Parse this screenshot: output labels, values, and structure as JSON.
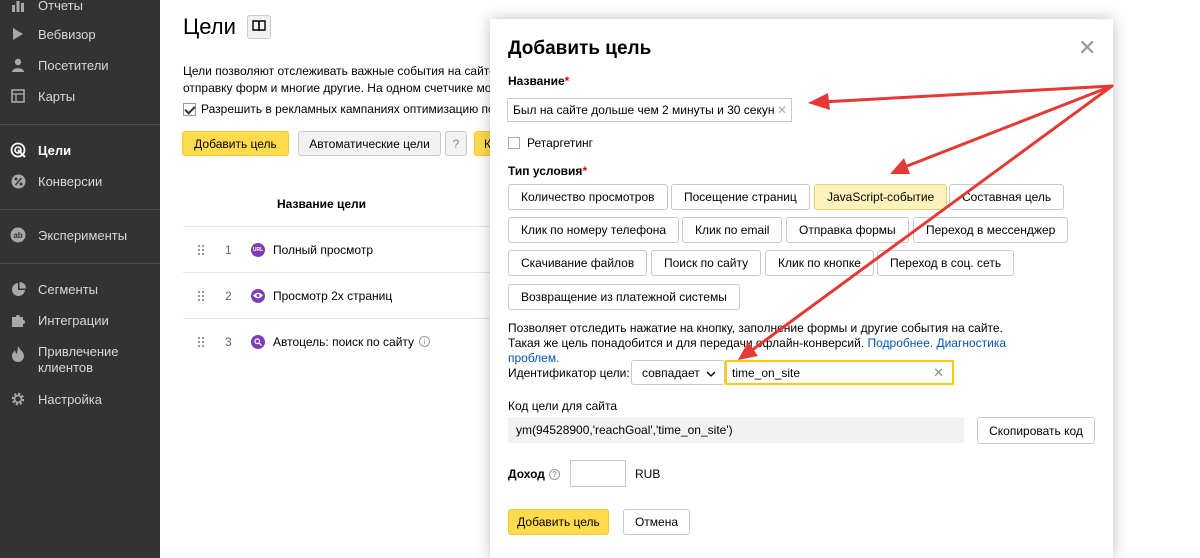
{
  "sidebar": {
    "items": [
      {
        "label": "Отчеты",
        "icon": "bar-chart-icon"
      },
      {
        "label": "Вебвизор",
        "icon": "play-icon"
      },
      {
        "label": "Посетители",
        "icon": "user-icon"
      },
      {
        "label": "Карты",
        "icon": "map-icon"
      },
      {
        "label": "Цели",
        "icon": "target-icon",
        "active": true
      },
      {
        "label": "Конверсии",
        "icon": "percent-icon"
      },
      {
        "label": "Эксперименты",
        "icon": "ab-icon"
      },
      {
        "label": "Сегменты",
        "icon": "pie-icon"
      },
      {
        "label": "Интеграции",
        "icon": "puzzle-icon"
      },
      {
        "label": "Привлечение клиентов",
        "icon": "flame-icon"
      },
      {
        "label": "Настройка",
        "icon": "gear-icon"
      }
    ]
  },
  "page": {
    "title": "Цели",
    "desc_line1": "Цели позволяют отслеживать важные события на сайте:",
    "desc_line2": "отправку форм и многие другие. На одном счетчике мо",
    "check_label": "Разрешить в рекламных кампаниях оптимизацию по",
    "add_goal_btn": "Добавить цель",
    "auto_goals_btn": "Автоматические цели",
    "help_btn": "?",
    "cut_btn": "К",
    "table_header": "Название цели",
    "goals": [
      {
        "num": "1",
        "name": "Полный просмотр",
        "icon_text": "URL"
      },
      {
        "num": "2",
        "name": "Просмотр 2х страниц",
        "icon_text": "eye"
      },
      {
        "num": "3",
        "name": "Автоцель: поиск по сайту",
        "icon_text": "search"
      }
    ]
  },
  "modal": {
    "title": "Добавить цель",
    "close": "✕",
    "name_label": "Название",
    "required_mark": "*",
    "name_value": "Был на сайте дольше чем 2 минуты и 30 секун",
    "retargeting_label": "Ретаргетинг",
    "condition_label": "Тип условия",
    "condition_types": [
      "Количество просмотров",
      "Посещение страниц",
      "JavaScript-событие",
      "Составная цель",
      "Клик по номеру телефона",
      "Клик по email",
      "Отправка формы",
      "Переход в мессенджер",
      "Скачивание файлов",
      "Поиск по сайту",
      "Клик по кнопке",
      "Переход в соц. сеть",
      "Возвращение из платежной системы"
    ],
    "selected_condition": "JavaScript-событие",
    "desc_text": "Позволяет отследить нажатие на кнопку, заполнение формы и другие события на сайте. Такая же цель понадобится и для передачи офлайн-конверсий.",
    "link_more": "Подробнее.",
    "link_diag": "Диагностика проблем.",
    "id_label": "Идентификатор цели:",
    "match_value": "совпадает",
    "id_value": "time_on_site",
    "code_label": "Код цели для сайта",
    "code_value": "ym(94528900,'reachGoal','time_on_site')",
    "copy_btn": "Скопировать код",
    "income_label": "Доход",
    "income_value": "",
    "currency": "RUB",
    "add_btn": "Добавить цель",
    "cancel_btn": "Отмена"
  },
  "colors": {
    "sidebar_bg": "#333333",
    "accent_yellow": "#ffdb4d",
    "selected_condition": "#fff1bb",
    "annotation_arrow": "#e53935"
  }
}
